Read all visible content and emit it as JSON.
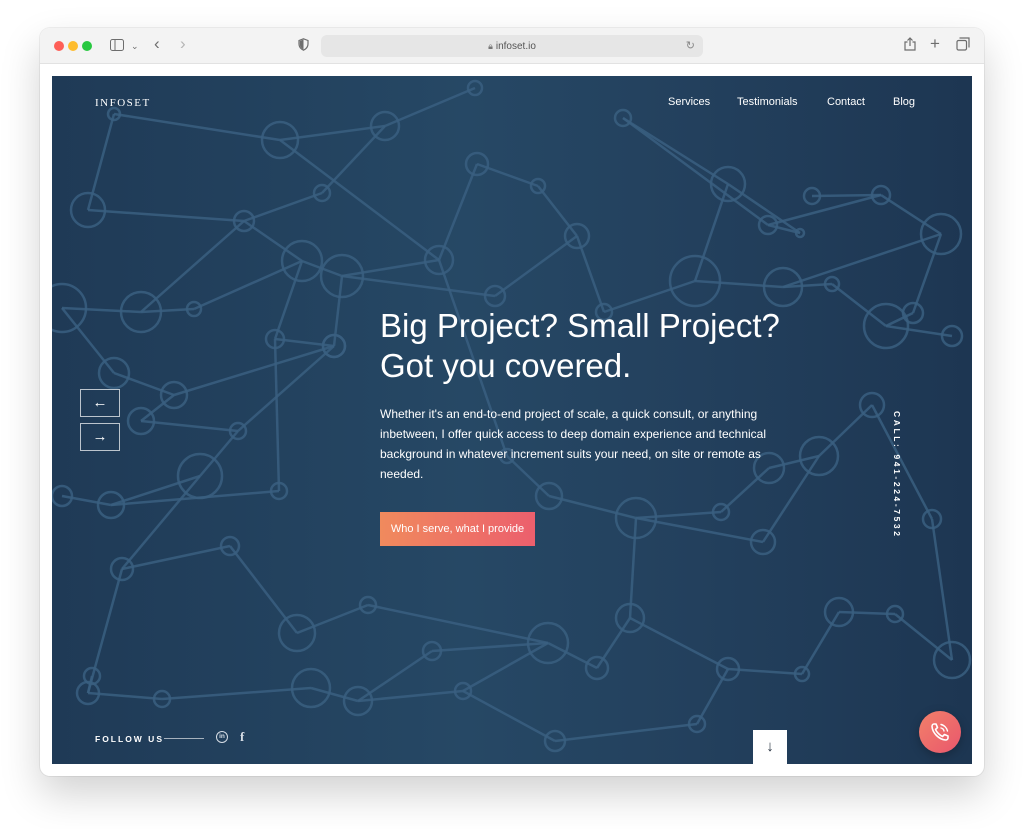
{
  "browser": {
    "url": "infoset.io"
  },
  "site": {
    "logo": "INFOSET",
    "nav": [
      "Services",
      "Testimonials",
      "Contact",
      "Blog"
    ],
    "hero": {
      "title": "Big Project? Small Project? Got you covered.",
      "description": "Whether it's an end-to-end project of scale, a quick consult, or anything inbetween, I offer quick access to deep domain experience and technical background in whatever increment suits your need, on site or remote as needed.",
      "cta": "Who I serve, what I provide"
    },
    "slider": {
      "prev_glyph": "←",
      "next_glyph": "→"
    },
    "call": "CALL: 941-224-7532",
    "follow": {
      "label": "FOLLOW US",
      "linkedin_glyph": "in",
      "facebook_glyph": "f"
    },
    "scroll_glyph": "↓"
  },
  "colors": {
    "background": "#23405d",
    "cta_start": "#f08a5d",
    "cta_end": "#ec5f6d"
  }
}
